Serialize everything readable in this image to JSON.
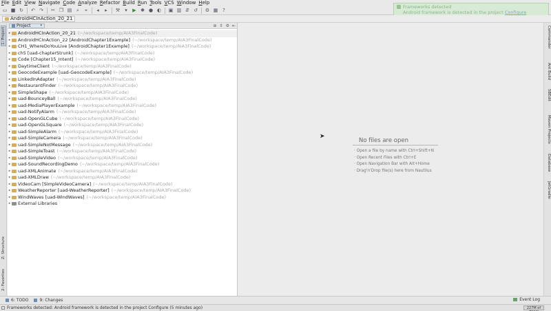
{
  "menu": [
    "File",
    "Edit",
    "View",
    "Navigate",
    "Code",
    "Analyze",
    "Refactor",
    "Build",
    "Run",
    "Tools",
    "VCS",
    "Window",
    "Help"
  ],
  "toolbar": {
    "icons": [
      "open-icon",
      "save-icon",
      "sync-icon",
      "undo-icon",
      "redo-icon",
      "cut-icon",
      "copy-icon",
      "paste-icon",
      "find-icon",
      "replace-icon",
      "back-icon",
      "forward-icon",
      "make-icon",
      "run-config-icon",
      "run-icon",
      "debug-icon",
      "stop-icon",
      "coverage-icon",
      "sdk-manager-icon",
      "avd-manager-icon",
      "vcs-icon",
      "history-icon",
      "settings-icon",
      "structure-icon",
      "help-icon"
    ]
  },
  "notification": {
    "title": "Frameworks detected",
    "body": "Android framework is detected in the project",
    "link": "Configure"
  },
  "breadcrumb": "AndroidHCInAction_20_21",
  "left_tabs": {
    "project": "1: Project",
    "structure": "Z: Structure",
    "favorites": "2: Favorites"
  },
  "right_tabs": [
    "Commander",
    "Ant Build",
    "SBEdit",
    "Maven Projects",
    "Database",
    "JetGradle"
  ],
  "project_panel": {
    "selector": "Project",
    "tree": [
      {
        "name": "AndroidHCInAction_20_21",
        "path": "(~/workspace/temp/AIA3FinalCode)",
        "selected": true,
        "expanded": false
      },
      {
        "name": "AndroidHCInAction_22 [AndroidChapter1Example]",
        "path": "(~/workspace/temp/AIA3FinalCode)"
      },
      {
        "name": "CH1_WhereDoYouLive [AndroidChapter1Example]",
        "path": "(~/workspace/temp/AIA3FinalCode)"
      },
      {
        "name": "ch5 [uad-chapterStrunk]",
        "path": "(~/workspace/temp/AIA3FinalCode)"
      },
      {
        "name": "Code [Chapter15_Intent]",
        "path": "(~/workspace/temp/AIA3FinalCode)"
      },
      {
        "name": "DaytimeClient",
        "path": "(~/workspace/temp/AIA3FinalCode)"
      },
      {
        "name": "GeocodeExample [uad-GeocodeExample]",
        "path": "(~/workspace/temp/AIA3FinalCode)"
      },
      {
        "name": "LinkedInAdapter",
        "path": "(~/workspace/temp/AIA3FinalCode)"
      },
      {
        "name": "RestaurantFinder",
        "path": "(~/workspace/temp/AIA3FinalCode)"
      },
      {
        "name": "SimpleShape",
        "path": "(~/workspace/temp/AIA3FinalCode)"
      },
      {
        "name": "uad-BounceyBall",
        "path": "(~/workspace/temp/AIA3FinalCode)"
      },
      {
        "name": "uad-MediaPlayerExample",
        "path": "(~/workspace/temp/AIA3FinalCode)"
      },
      {
        "name": "uad-NotifyAlarm",
        "path": "(~/workspace/temp/AIA3FinalCode)"
      },
      {
        "name": "uad-OpenGLCube",
        "path": "(~/workspace/temp/AIA3FinalCode)"
      },
      {
        "name": "uad-OpenGLSquare",
        "path": "(~/workspace/temp/AIA3FinalCode)"
      },
      {
        "name": "uad-SimpleAlarm",
        "path": "(~/workspace/temp/AIA3FinalCode)"
      },
      {
        "name": "uad-SimpleCamera",
        "path": "(~/workspace/temp/AIA3FinalCode)"
      },
      {
        "name": "uad-SimpleNotMessage",
        "path": "(~/workspace/temp/AIA3FinalCode)"
      },
      {
        "name": "uad-SimpleToast",
        "path": "(~/workspace/temp/AIA3FinalCode)"
      },
      {
        "name": "uad-SimpleVideo",
        "path": "(~/workspace/temp/AIA3FinalCode)"
      },
      {
        "name": "uad-SoundRecordingDemo",
        "path": "(~/workspace/temp/AIA3FinalCode)"
      },
      {
        "name": "uad-XMLAnimate",
        "path": "(~/workspace/temp/AIA3FinalCode)"
      },
      {
        "name": "uad-XMLDraw",
        "path": "(~/workspace/temp/AIA3FinalCode)"
      },
      {
        "name": "VideoCam [SimpleVideoCamera]",
        "path": "(~/workspace/temp/AIA3FinalCode)"
      },
      {
        "name": "WeatherReporter [uad-WeatherReporter]",
        "path": "(~/workspace/temp/AIA3FinalCode)"
      },
      {
        "name": "WindWaves [uad-WindWaves]",
        "path": "(~/workspace/temp/AIA3FinalCode)"
      },
      {
        "name": "External Libraries",
        "path": "",
        "library": true
      }
    ]
  },
  "editor": {
    "empty_title": "No files are open",
    "hints": [
      "Open a file by name with Ctrl+Shift+N",
      "Open Recent Files with Ctrl+E",
      "Open Navigation Bar with Alt+Home",
      "Drag'n'Drop file(s) here from Nautilus"
    ]
  },
  "bottom_tabs": {
    "todo": "6: TODO",
    "changes": "9: Changes",
    "event_log": "Event Log"
  },
  "status": {
    "message": "Frameworks detected: Android framework is detected in the project Configure (5 minutes ago)",
    "memory": "227M of 711M"
  }
}
